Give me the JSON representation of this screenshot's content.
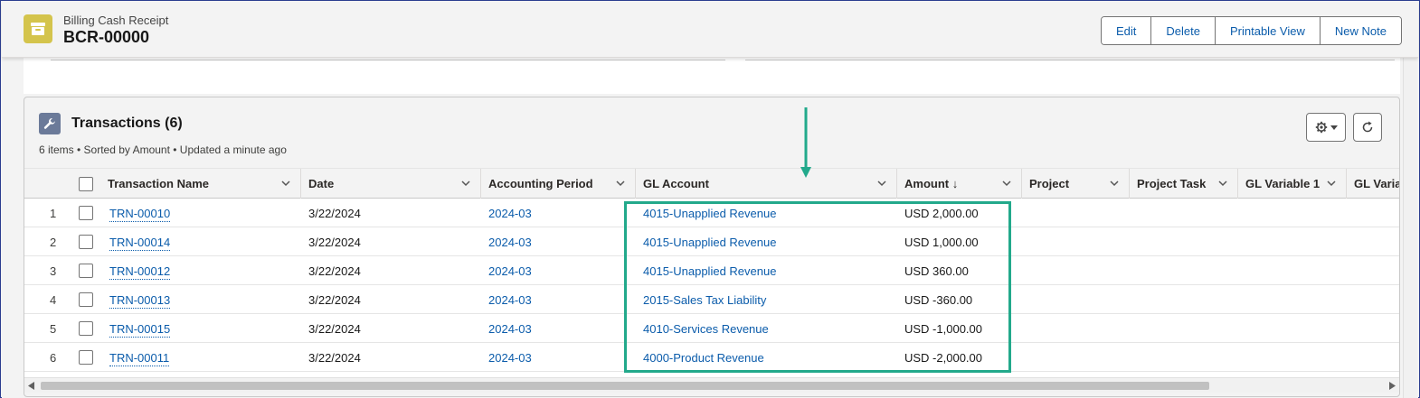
{
  "header": {
    "object_type": "Billing Cash Receipt",
    "record_name": "BCR-00000",
    "actions": [
      "Edit",
      "Delete",
      "Printable View",
      "New Note"
    ]
  },
  "related_list": {
    "title": "Transactions (6)",
    "subtitle": "6 items • Sorted by Amount • Updated a minute ago",
    "icon": "wrench-icon",
    "columns": [
      "Transaction Name",
      "Date",
      "Accounting Period",
      "GL Account",
      "Amount ↓",
      "Project",
      "Project Task",
      "GL Variable 1",
      "GL Varia"
    ],
    "rows": [
      {
        "num": "1",
        "name": "TRN-00010",
        "date": "3/22/2024",
        "period": "2024-03",
        "gl_account": "4015-Unapplied Revenue",
        "amount": "USD 2,000.00"
      },
      {
        "num": "2",
        "name": "TRN-00014",
        "date": "3/22/2024",
        "period": "2024-03",
        "gl_account": "4015-Unapplied Revenue",
        "amount": "USD 1,000.00"
      },
      {
        "num": "3",
        "name": "TRN-00012",
        "date": "3/22/2024",
        "period": "2024-03",
        "gl_account": "4015-Unapplied Revenue",
        "amount": "USD 360.00"
      },
      {
        "num": "4",
        "name": "TRN-00013",
        "date": "3/22/2024",
        "period": "2024-03",
        "gl_account": "2015-Sales Tax Liability",
        "amount": "USD -360.00"
      },
      {
        "num": "5",
        "name": "TRN-00015",
        "date": "3/22/2024",
        "period": "2024-03",
        "gl_account": "4010-Services Revenue",
        "amount": "USD -1,000.00"
      },
      {
        "num": "6",
        "name": "TRN-00011",
        "date": "3/22/2024",
        "period": "2024-03",
        "gl_account": "4000-Product Revenue",
        "amount": "USD -2,000.00"
      }
    ]
  },
  "colors": {
    "link": "#0b5cab",
    "highlight": "#22a98b",
    "object_icon": "#d4c44c"
  }
}
